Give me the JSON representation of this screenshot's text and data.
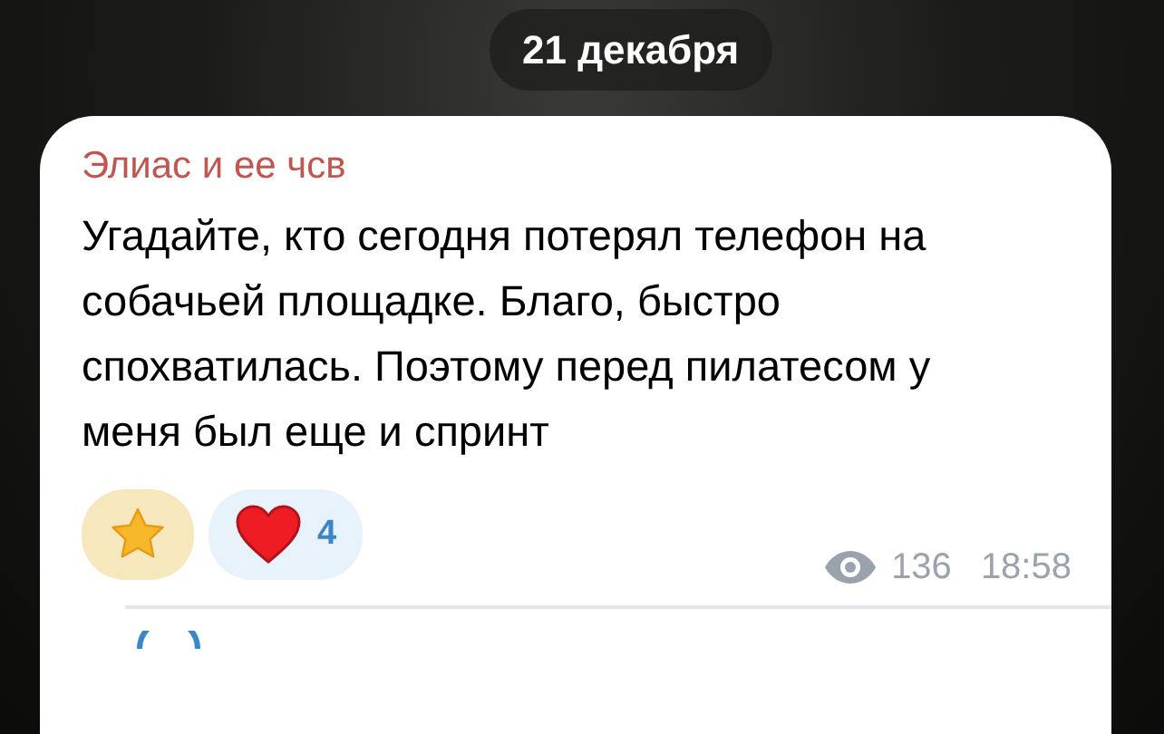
{
  "date_pill": "21 декабря",
  "message": {
    "author": "Элиас и ее чсв",
    "text": "Угадайте, кто сегодня потерял телефон на собачьей площадке. Благо, быстро спохватилась. Поэтому перед пилатесом у меня был еще и спринт",
    "reactions": [
      {
        "kind": "star",
        "selected": false
      },
      {
        "kind": "heart",
        "count": "4",
        "selected": false
      }
    ],
    "views": "136",
    "time": "18:58"
  }
}
